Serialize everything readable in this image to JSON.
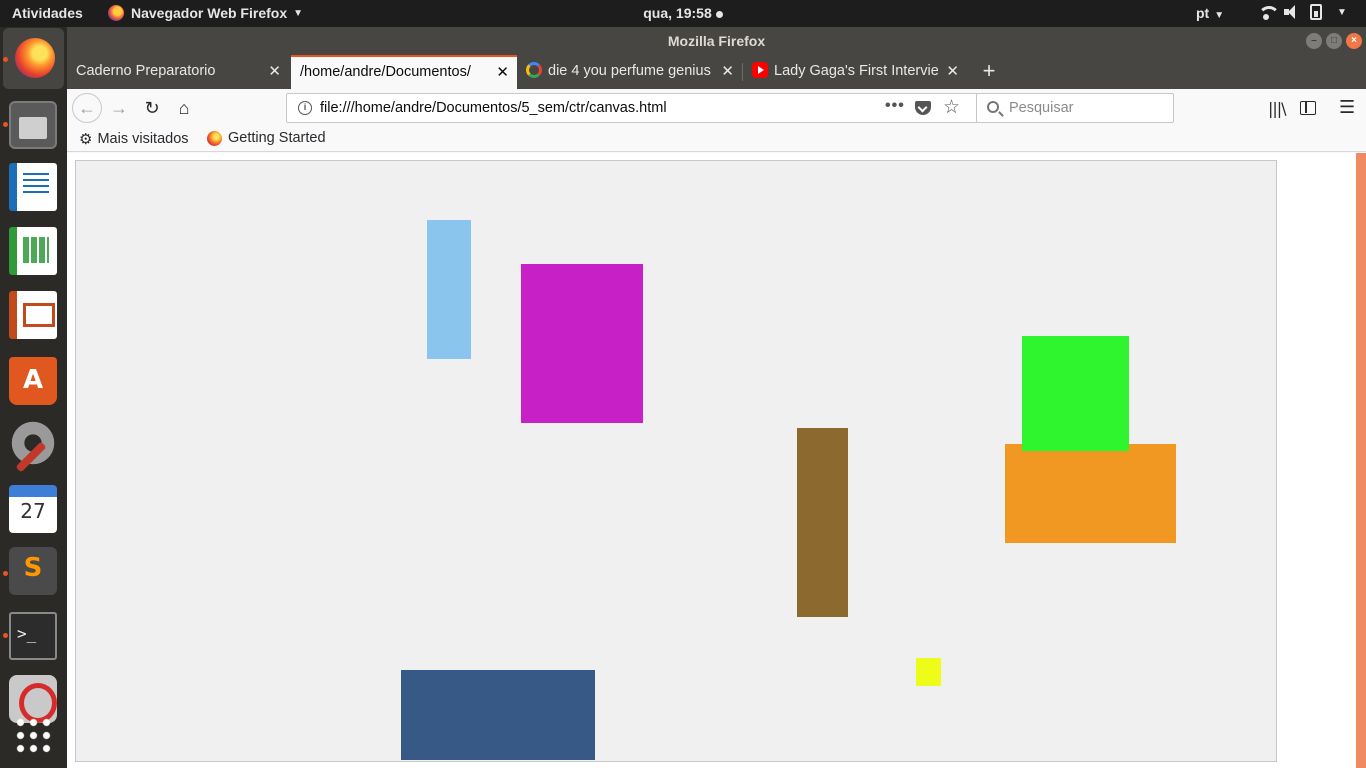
{
  "topbar": {
    "activities": "Atividades",
    "app_menu": "Navegador Web Firefox",
    "clock": "qua, 19:58",
    "language": "pt"
  },
  "dock": {
    "items": [
      {
        "name": "firefox-icon",
        "active": true
      },
      {
        "name": "files-icon"
      },
      {
        "name": "libreoffice-writer-icon"
      },
      {
        "name": "libreoffice-calc-icon"
      },
      {
        "name": "libreoffice-impress-icon"
      },
      {
        "name": "ubuntu-software-icon"
      },
      {
        "name": "settings-icon"
      },
      {
        "name": "calendar-icon",
        "label": "27"
      },
      {
        "name": "sublime-text-icon"
      },
      {
        "name": "terminal-icon"
      },
      {
        "name": "opera-icon"
      },
      {
        "name": "show-applications-icon"
      }
    ]
  },
  "window": {
    "title": "Mozilla Firefox"
  },
  "tabs": [
    {
      "label": "Caderno Preparatorio",
      "selected": false
    },
    {
      "label": "/home/andre/Documentos/",
      "selected": true
    },
    {
      "label": "die 4 you perfume genius",
      "favicon": "google-icon",
      "selected": false
    },
    {
      "label": "Lady Gaga's First Intervie",
      "favicon": "youtube-icon",
      "selected": false
    }
  ],
  "navbar": {
    "url": "file:///home/andre/Documentos/5_sem/ctr/canvas.html",
    "search_placeholder": "Pesquisar",
    "more_label": "•••"
  },
  "bookmarks": [
    {
      "label": "Mais visitados",
      "icon": "gear-icon"
    },
    {
      "label": "Getting Started",
      "icon": "firefox-icon"
    }
  ],
  "canvas": {
    "background": "#f0f0f0",
    "rectangles": [
      {
        "color": "#8ac5ed"
      },
      {
        "color": "#c820c7"
      },
      {
        "color": "#8c6a2f"
      },
      {
        "color": "#f09822"
      },
      {
        "color": "#2ef52e"
      },
      {
        "color": "#375986"
      },
      {
        "color": "#eefc1a"
      }
    ]
  },
  "colors": {
    "accent": "#e95420",
    "topbar": "#1d1d1d",
    "titlebar": "#474642"
  }
}
